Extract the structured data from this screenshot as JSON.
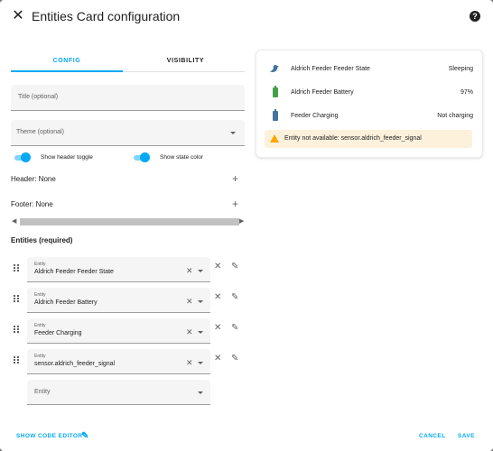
{
  "dialog": {
    "title": "Entities Card configuration"
  },
  "tabs": [
    {
      "label": "CONFIG"
    },
    {
      "label": "VISIBILITY"
    }
  ],
  "form": {
    "title_placeholder": "Title (optional)",
    "theme_placeholder": "Theme (optional)",
    "toggles": [
      {
        "label": "Show header toggle",
        "on": true
      },
      {
        "label": "Show state color",
        "on": true
      }
    ],
    "header_label": "Header: None",
    "footer_label": "Footer: None",
    "entities_title": "Entities (required)",
    "entity_field_label": "Entity",
    "entities": [
      {
        "value": "Aldrich Feeder Feeder State"
      },
      {
        "value": "Aldrich Feeder Battery"
      },
      {
        "value": "Feeder Charging"
      },
      {
        "value": "sensor.aldrich_feeder_signal"
      }
    ],
    "new_entity_placeholder": "Entity"
  },
  "preview": {
    "rows": [
      {
        "name": "Aldrich Feeder Feeder State",
        "state": "Sleeping",
        "icon": "bird-icon"
      },
      {
        "name": "Aldrich Feeder Battery",
        "state": "97%",
        "icon": "battery-icon"
      },
      {
        "name": "Feeder Charging",
        "state": "Not charging",
        "icon": "battery-icon"
      }
    ],
    "warning": "Entity not available: sensor.aldrich_feeder_signal"
  },
  "footer": {
    "show_code_editor": "SHOW CODE EDITOR",
    "cancel": "CANCEL",
    "save": "SAVE"
  },
  "colors": {
    "accent": "#03a9f4",
    "bird_icon": "#44739e",
    "battery_full": "#43a047",
    "battery_charging": "#44739e",
    "warning": "#ffa600"
  }
}
